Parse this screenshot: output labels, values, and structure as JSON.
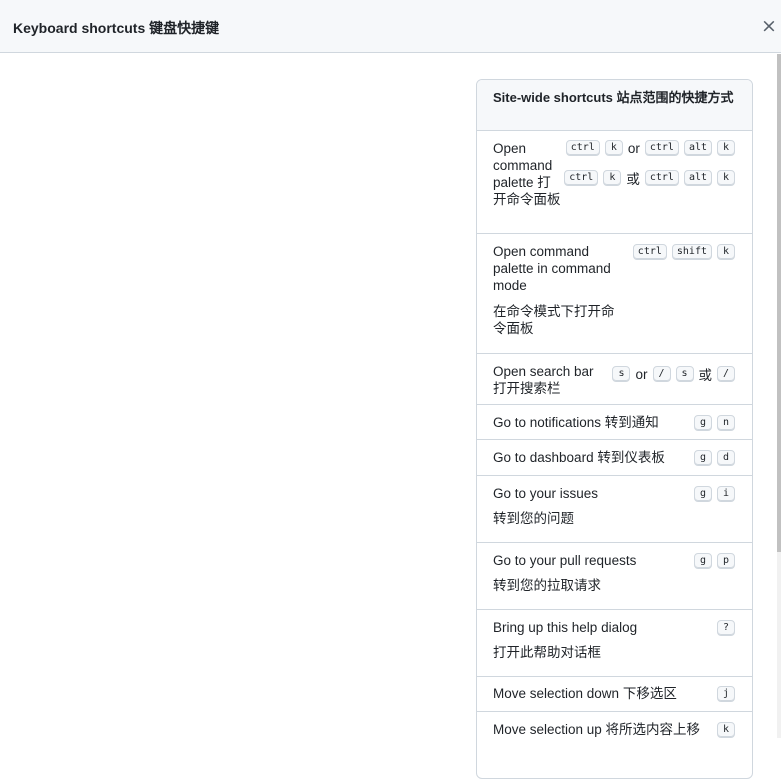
{
  "dialog": {
    "title": "Keyboard shortcuts  键盘快捷键",
    "close_glyph": "×"
  },
  "section": {
    "title": "Site-wide shortcuts  站点范围的快捷方式"
  },
  "shortcuts": [
    {
      "desc": "Open command palette 打开命令面板",
      "line1": [
        "ctrl",
        "k"
      ],
      "or": "or",
      "line1b": [
        "ctrl",
        "alt",
        "k"
      ],
      "line2": [
        "ctrl",
        "k"
      ],
      "or2": "或",
      "line2b": [
        "ctrl",
        "alt",
        "k"
      ]
    },
    {
      "desc": "Open command palette in command mode",
      "desc2": "在命令模式下打开命令面板",
      "keys": [
        "ctrl",
        "shift",
        "k"
      ]
    },
    {
      "desc": "Open search bar 打开搜索栏",
      "keys_a": [
        "s"
      ],
      "or": "or",
      "keys_b": [
        "/"
      ],
      "keys_c": [
        "s"
      ],
      "or2": "或",
      "keys_d": [
        "/"
      ]
    },
    {
      "desc": "Go to notifications 转到通知",
      "keys": [
        "g",
        "n"
      ]
    },
    {
      "desc": "Go to dashboard 转到仪表板",
      "keys": [
        "g",
        "d"
      ]
    },
    {
      "desc": "Go to your issues",
      "desc2": "转到您的问题",
      "keys": [
        "g",
        "i"
      ]
    },
    {
      "desc": "Go to your pull requests",
      "desc2": "转到您的拉取请求",
      "keys": [
        "g",
        "p"
      ]
    },
    {
      "desc": "Bring up this help dialog",
      "desc2": "打开此帮助对话框",
      "keys": [
        "?"
      ]
    },
    {
      "desc": "Move selection down 下移选区",
      "keys": [
        "j"
      ]
    },
    {
      "desc": "Move selection up 将所选内容上移",
      "keys": [
        "k"
      ]
    }
  ]
}
